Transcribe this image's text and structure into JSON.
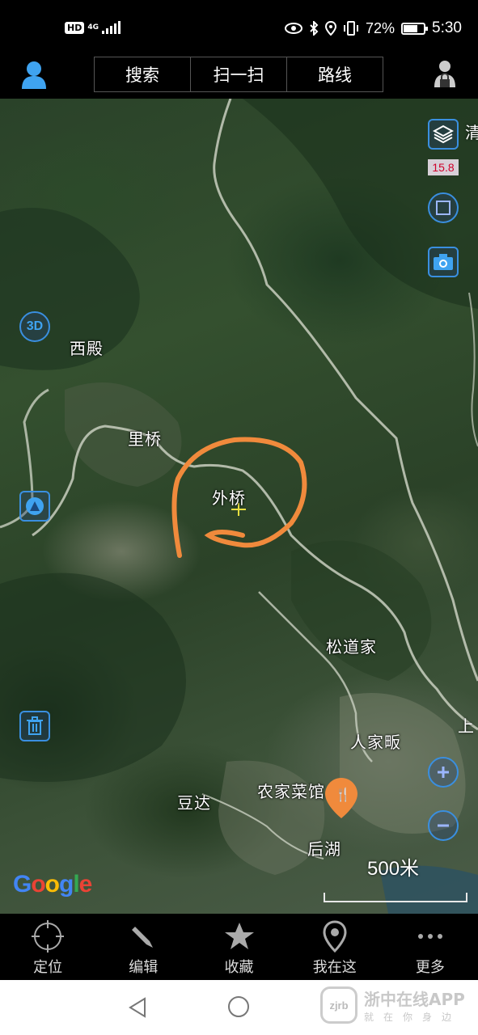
{
  "status_bar": {
    "network_badge": "HD",
    "network_type": "4G",
    "battery_percent": "72%",
    "battery_level": 0.72,
    "time": "5:30",
    "icons": [
      "eye-icon",
      "bluetooth-icon",
      "location-icon",
      "vibrate-icon"
    ]
  },
  "top_bar": {
    "tabs": [
      {
        "label": "搜索"
      },
      {
        "label": "扫一扫"
      },
      {
        "label": "路线"
      }
    ]
  },
  "map": {
    "zoom_level": "15.8",
    "edge_labels": [
      "清",
      "上"
    ],
    "places": [
      {
        "label": "西殿"
      },
      {
        "label": "里桥"
      },
      {
        "label": "外桥"
      },
      {
        "label": "松道家"
      },
      {
        "label": "人家畈"
      },
      {
        "label": "农家菜馆"
      },
      {
        "label": "豆达"
      },
      {
        "label": "后湖"
      }
    ],
    "controls": {
      "three_d_label": "3D"
    },
    "attribution": "Google",
    "scale_label": "500米",
    "colors": {
      "annotation_stroke": "#f08a3c",
      "control_border": "#3a8fe0",
      "restaurant_pin": "#f08a3c"
    }
  },
  "toolbar": {
    "items": [
      {
        "label": "定位",
        "icon": "crosshair-icon"
      },
      {
        "label": "编辑",
        "icon": "pencil-icon"
      },
      {
        "label": "收藏",
        "icon": "star-icon"
      },
      {
        "label": "我在这",
        "icon": "pin-icon"
      },
      {
        "label": "更多",
        "icon": "more-icon"
      }
    ]
  },
  "nav_bar": {
    "watermark_title": "浙中在线APP",
    "watermark_subtitle": "就在你身边",
    "watermark_logo": "zjrb"
  }
}
